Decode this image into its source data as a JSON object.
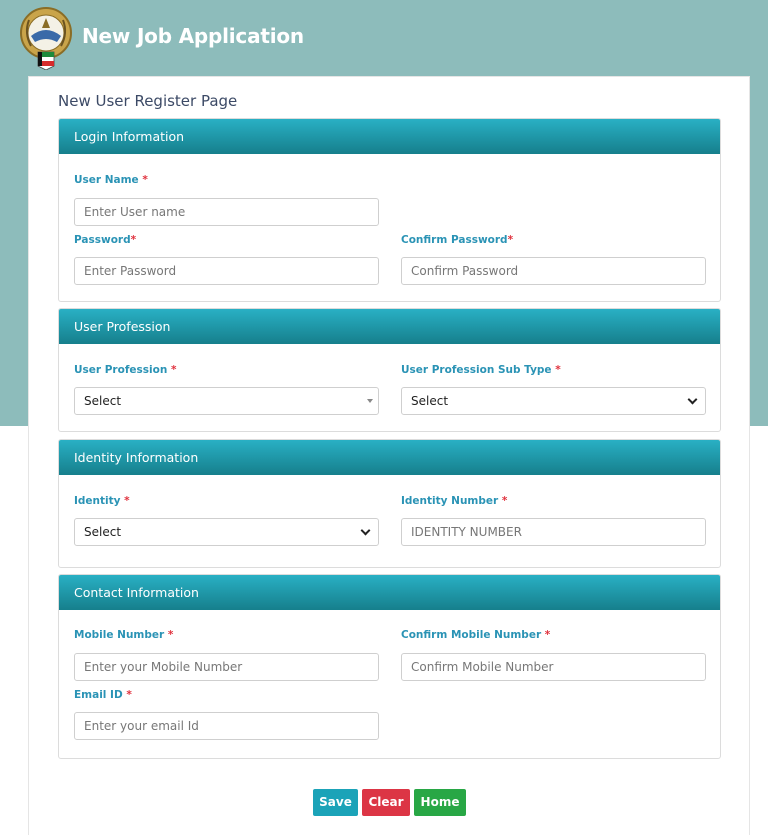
{
  "header": {
    "title": "New Job Application"
  },
  "page": {
    "title": "New User Register Page"
  },
  "login": {
    "heading": "Login Information",
    "username_label": "User Name",
    "username_placeholder": "Enter User name",
    "password_label": "Password",
    "password_placeholder": "Enter Password",
    "confirm_password_label": "Confirm Password",
    "confirm_password_placeholder": "Confirm Password"
  },
  "profession": {
    "heading": "User Profession",
    "profession_label": "User Profession",
    "profession_value": "Select",
    "subtype_label": "User Profession Sub Type",
    "subtype_value": "Select"
  },
  "identity": {
    "heading": "Identity Information",
    "identity_label": "Identity",
    "identity_value": "Select",
    "number_label": "Identity Number",
    "number_placeholder": "IDENTITY NUMBER"
  },
  "contact": {
    "heading": "Contact Information",
    "mobile_label": "Mobile Number",
    "mobile_placeholder": "Enter your Mobile Number",
    "confirm_mobile_label": "Confirm Mobile Number",
    "confirm_mobile_placeholder": "Confirm Mobile Number",
    "email_label": "Email ID",
    "email_placeholder": "Enter your email Id"
  },
  "required_mark": "*",
  "buttons": {
    "save": "Save",
    "clear": "Clear",
    "home": "Home"
  },
  "colors": {
    "header_bg": "#8dbcbb",
    "panel_header": "#1e98aa",
    "label": "#2a93b5",
    "save": "#1ba3b8",
    "clear": "#dc3545",
    "home": "#28a745"
  }
}
